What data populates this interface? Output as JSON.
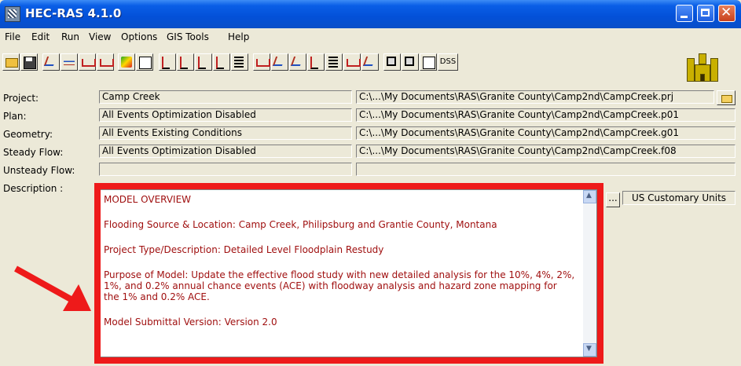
{
  "window": {
    "title": "HEC-RAS 4.1.0"
  },
  "menu": [
    "File",
    "Edit",
    "Run",
    "View",
    "Options",
    "GIS Tools",
    "Help"
  ],
  "toolbar": {
    "dss_label": "DSS",
    "icons": [
      "open-project-icon",
      "save-project-icon",
      "geometry-editor-icon",
      "steady-flow-icon",
      "unsteady-flow-icon",
      "quasi-unsteady-icon",
      "sediment-data-icon",
      "water-quality-icon",
      "steady-analysis-icon",
      "unsteady-analysis-icon",
      "sediment-analysis-icon",
      "water-quality-analysis-icon",
      "hydraulic-design-icon",
      "cross-section-plot-icon",
      "profile-plot-icon",
      "general-profile-plot-icon",
      "rating-curve-icon",
      "xyz-perspective-icon",
      "stage-flow-hydrograph-icon",
      "hydraulic-property-tables-icon",
      "detailed-output-table-icon",
      "profile-summary-table-icon",
      "summary-errors-icon",
      "dss-viewer-icon",
      "usace-castle-logo"
    ]
  },
  "labels": {
    "project": "Project:",
    "plan": "Plan:",
    "geometry": "Geometry:",
    "steady_flow": "Steady Flow:",
    "unsteady_flow": "Unsteady Flow:",
    "description": "Description :"
  },
  "values": {
    "project": "Camp Creek",
    "plan": "All Events Optimization Disabled",
    "geometry": "All Events Existing Conditions",
    "steady_flow": "All Events Optimization Disabled",
    "unsteady_flow": ""
  },
  "files": {
    "project": "C:\\...\\My Documents\\RAS\\Granite County\\Camp2nd\\CampCreek.prj",
    "plan": "C:\\...\\My Documents\\RAS\\Granite County\\Camp2nd\\CampCreek.p01",
    "geometry": "C:\\...\\My Documents\\RAS\\Granite County\\Camp2nd\\CampCreek.g01",
    "steady_flow": "C:\\...\\My Documents\\RAS\\Granite County\\Camp2nd\\CampCreek.f08",
    "unsteady_flow": ""
  },
  "description": {
    "heading": "MODEL OVERVIEW",
    "flooding_source": "Flooding Source & Location:   Camp Creek, Philipsburg and Grantie County, Montana",
    "project_type": "Project Type/Description:      Detailed Level Floodplain Restudy",
    "purpose": "Purpose of Model:   Update the effective flood study with new detailed analysis for the 10%, 4%, 2%, 1%, and 0.2% annual chance events (ACE) with floodway analysis and hazard zone mapping for the 1% and 0.2% ACE.",
    "submittal": "Model Submittal Version:        Version 2.0"
  },
  "ellipsis_label": "...",
  "units": "US Customary Units",
  "colors": {
    "highlight": "#ee1a1a",
    "description_text": "#a01010",
    "title_bar": "#0350d8"
  }
}
